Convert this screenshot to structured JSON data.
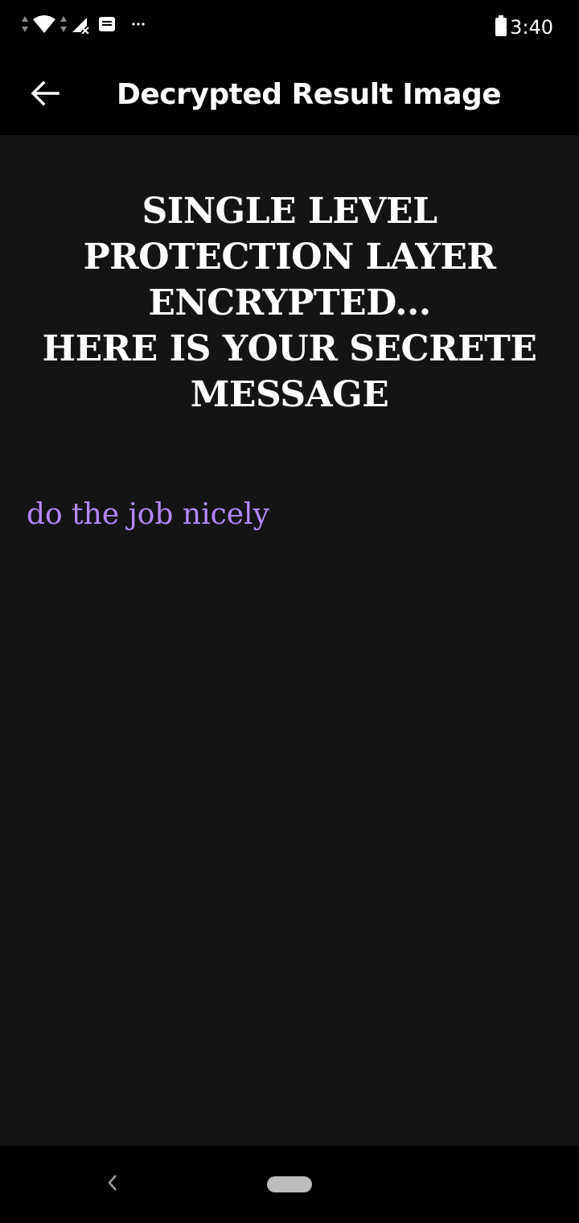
{
  "status_bar": {
    "time": "3:40",
    "icons": [
      "data-arrows-icon",
      "wifi-icon",
      "data-arrows-icon",
      "signal-no-service-icon",
      "notification-icon",
      "more-notifications-icon",
      "battery-icon"
    ]
  },
  "app_bar": {
    "title": "Decrypted Result Image",
    "back_icon": "arrow-back-icon"
  },
  "main": {
    "heading_lines": [
      "SINGLE LEVEL",
      "PROTECTION LAYER",
      "ENCRYPTED...",
      "HERE IS YOUR SECRETE",
      "MESSAGE"
    ],
    "message": "do the job nicely",
    "message_color": "#b388ff"
  },
  "nav_bar": {
    "back_icon": "chevron-left-icon",
    "home_icon": "home-pill-icon"
  }
}
